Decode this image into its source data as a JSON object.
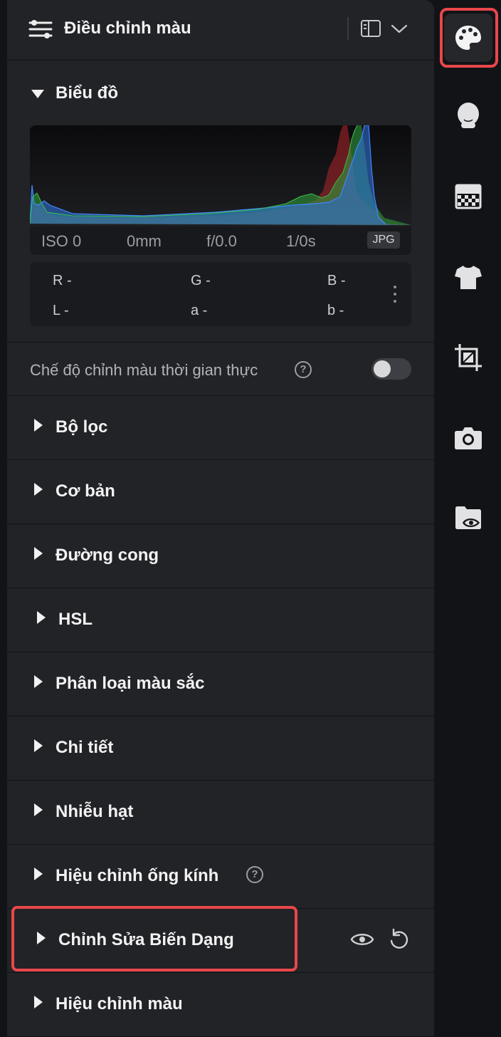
{
  "header": {
    "title": "Điều chỉnh màu"
  },
  "histogram": {
    "title": "Biểu đồ",
    "exif": {
      "iso": "ISO 0",
      "focal": "0mm",
      "aperture": "f/0.0",
      "shutter": "1/0s",
      "format": "JPG"
    },
    "readout": {
      "r": "R -",
      "g": "G -",
      "b": "B -",
      "l": "L -",
      "a": "a -",
      "b2": "b -"
    },
    "colors": {
      "red": "#b3262c",
      "green": "#2f9a3a",
      "blue": "#2f6fd6"
    }
  },
  "realtime": {
    "label": "Chế độ chỉnh màu thời gian thực",
    "help": "?",
    "enabled": false
  },
  "sections": [
    {
      "label": "Bộ lọc"
    },
    {
      "label": "Cơ bản"
    },
    {
      "label": "Đường cong"
    },
    {
      "label": "HSL"
    },
    {
      "label": "Phân loại màu sắc"
    },
    {
      "label": "Chi tiết"
    },
    {
      "label": "Nhiễu hạt"
    },
    {
      "label": "Hiệu chỉnh ống kính",
      "help": "?"
    },
    {
      "label": "Chỉnh Sửa Biến Dạng"
    },
    {
      "label": "Hiệu chỉnh màu"
    }
  ],
  "rail": {
    "items": [
      "palette-icon",
      "face-icon",
      "gradient-icon",
      "shirt-icon",
      "crop-icon",
      "camera-icon",
      "folder-eye-icon"
    ],
    "active": "palette-icon"
  },
  "theme": {
    "panel_bg": "#222326",
    "rail_bg": "#121316",
    "highlight": "#e9474b"
  }
}
